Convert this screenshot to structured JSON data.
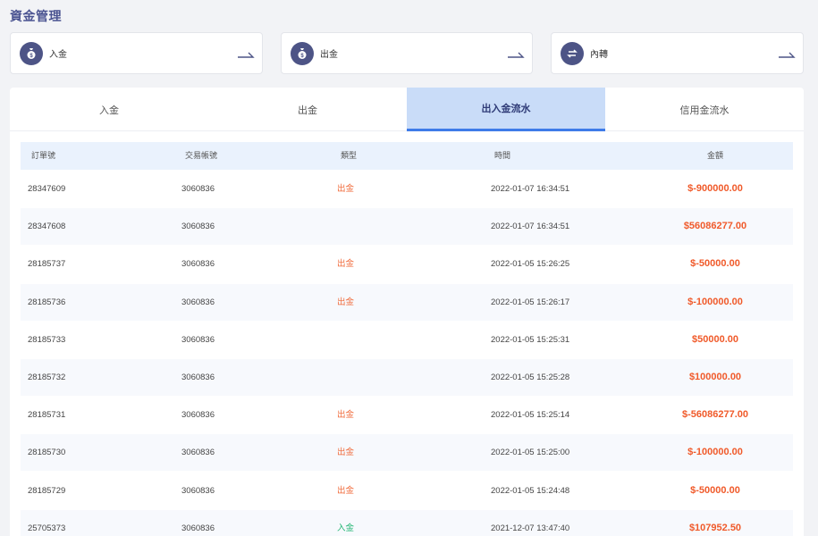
{
  "page": {
    "title": "資金管理"
  },
  "actions": [
    {
      "label": "入金"
    },
    {
      "label": "出金"
    },
    {
      "label": "內轉"
    }
  ],
  "tabs": [
    {
      "label": "入金"
    },
    {
      "label": "出金"
    },
    {
      "label": "出入金流水"
    },
    {
      "label": "信用金流水"
    }
  ],
  "table": {
    "headers": [
      "訂單號",
      "交易帳號",
      "類型",
      "時間",
      "金額"
    ],
    "rows": [
      {
        "id": "28347609",
        "account": "3060836",
        "type": "出金",
        "time": "2022-01-07 16:34:51",
        "amount": "$-900000.00"
      },
      {
        "id": "28347608",
        "account": "3060836",
        "type": "",
        "time": "2022-01-07 16:34:51",
        "amount": "$56086277.00"
      },
      {
        "id": "28185737",
        "account": "3060836",
        "type": "出金",
        "time": "2022-01-05 15:26:25",
        "amount": "$-50000.00"
      },
      {
        "id": "28185736",
        "account": "3060836",
        "type": "出金",
        "time": "2022-01-05 15:26:17",
        "amount": "$-100000.00"
      },
      {
        "id": "28185733",
        "account": "3060836",
        "type": "",
        "time": "2022-01-05 15:25:31",
        "amount": "$50000.00"
      },
      {
        "id": "28185732",
        "account": "3060836",
        "type": "",
        "time": "2022-01-05 15:25:28",
        "amount": "$100000.00"
      },
      {
        "id": "28185731",
        "account": "3060836",
        "type": "出金",
        "time": "2022-01-05 15:25:14",
        "amount": "$-56086277.00"
      },
      {
        "id": "28185730",
        "account": "3060836",
        "type": "出金",
        "time": "2022-01-05 15:25:00",
        "amount": "$-100000.00"
      },
      {
        "id": "28185729",
        "account": "3060836",
        "type": "出金",
        "time": "2022-01-05 15:24:48",
        "amount": "$-50000.00"
      },
      {
        "id": "25705373",
        "account": "3060836",
        "type": "入金",
        "time": "2021-12-07 13:47:40",
        "amount": "$107952.50"
      }
    ]
  },
  "colors": {
    "accent": "#3e7be8",
    "title": "#4a5391",
    "negative": "#f05a2a",
    "positive": "#22b573",
    "icon_bg": "#4d5486"
  }
}
